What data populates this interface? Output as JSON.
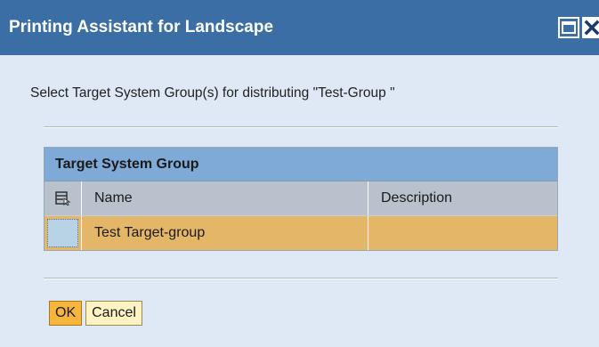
{
  "window": {
    "title": "Printing Assistant for Landscape",
    "maximize_icon": "maximize-icon",
    "close_icon": "close-icon"
  },
  "prompt": "Select Target System Group(s) for distributing \"Test-Group \"",
  "table": {
    "title": "Target System Group",
    "select_all_icon": "select-columns-icon",
    "columns": [
      "Name",
      "Description"
    ],
    "rows": [
      {
        "name": "Test Target-group",
        "description": ""
      }
    ]
  },
  "buttons": {
    "ok_label": "OK",
    "cancel_label": "Cancel"
  },
  "colors": {
    "titlebar": "#3a6ea5",
    "table_title": "#7fa9d6",
    "selected_row": "#e4b768",
    "ok_button": "#f5b63b"
  }
}
